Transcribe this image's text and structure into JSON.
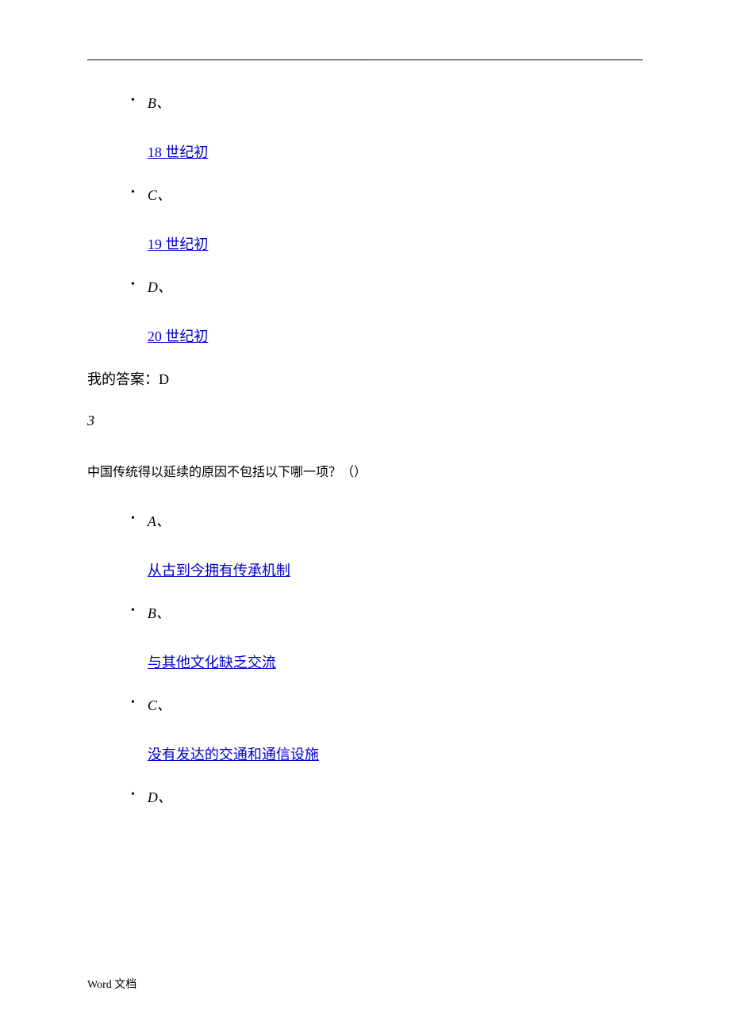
{
  "header": {
    "dot": "."
  },
  "question2_partial": {
    "options": [
      {
        "label": "B、",
        "text": "18 世纪初"
      },
      {
        "label": "C、",
        "text": "19 世纪初"
      },
      {
        "label": "D、",
        "text": "20 世纪初"
      }
    ],
    "my_answer": "我的答案：D"
  },
  "question3": {
    "number": "3",
    "text": "中国传统得以延续的原因不包括以下哪一项？（）",
    "options": [
      {
        "label": "A、",
        "text": "从古到今拥有传承机制"
      },
      {
        "label": "B、",
        "text": "与其他文化缺乏交流"
      },
      {
        "label": "C、",
        "text": "没有发达的交通和通信设施"
      },
      {
        "label": "D、",
        "text": ""
      }
    ]
  },
  "footer": {
    "text": "Word  文档"
  }
}
